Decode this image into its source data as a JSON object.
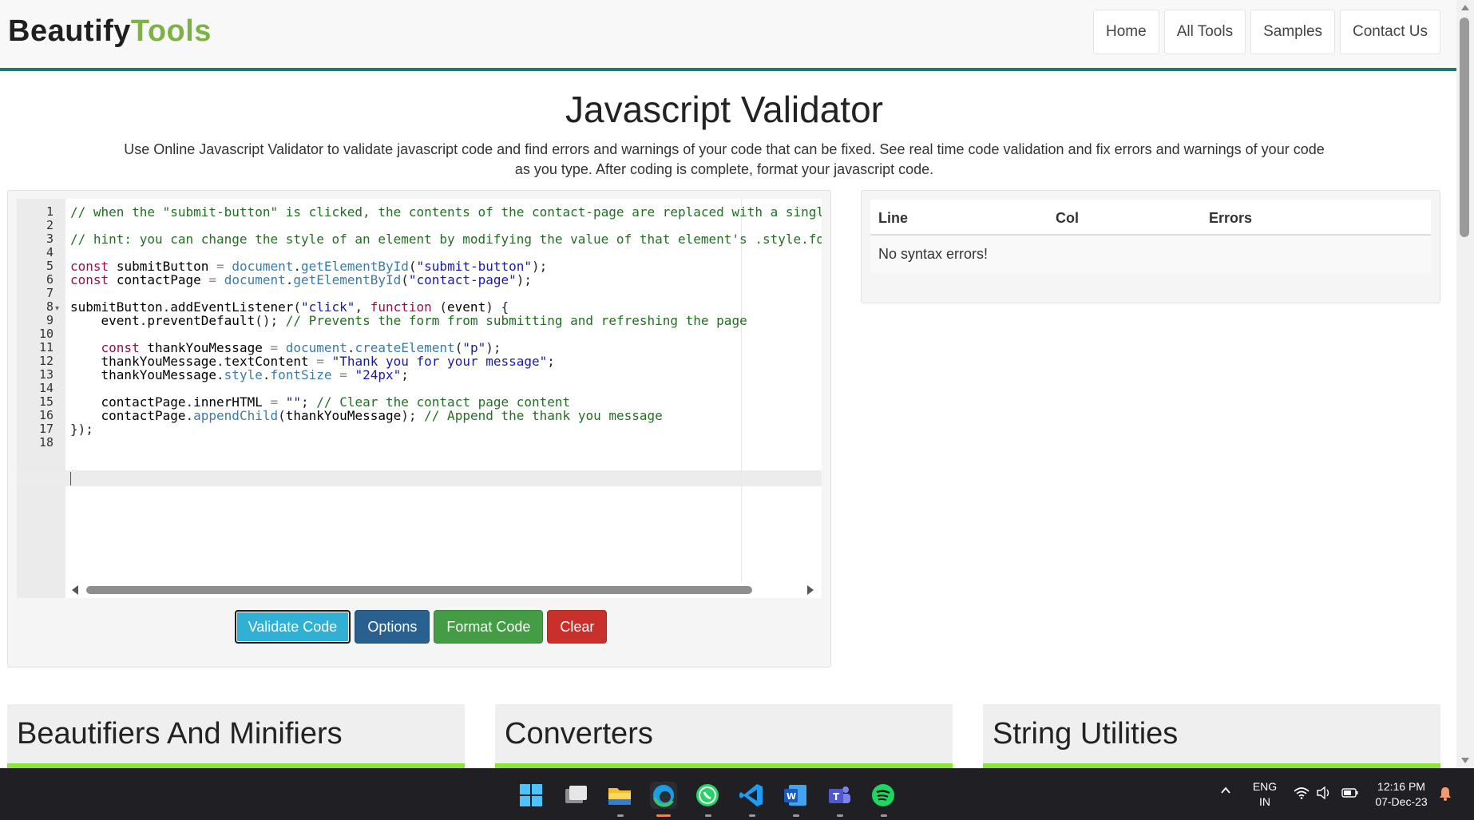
{
  "header": {
    "logo_part1": "Beautify",
    "logo_part2": "Tools",
    "nav": [
      "Home",
      "All Tools",
      "Samples",
      "Contact Us"
    ]
  },
  "page": {
    "title": "Javascript Validator",
    "description": "Use Online Javascript Validator to validate javascript code and find errors and warnings of your code that can be fixed. See real time code validation and fix errors and warnings of your code as you type. After coding is complete, format your javascript code."
  },
  "editor": {
    "line_numbers": [
      "1",
      "2",
      "3",
      "4",
      "5",
      "6",
      "7",
      "8",
      "9",
      "10",
      "11",
      "12",
      "13",
      "14",
      "15",
      "16",
      "17",
      "18"
    ],
    "lines": [
      "// when the \"submit-button\" is clicked, the contents of the contact-page are replaced with a singl",
      "",
      "// hint: you can change the style of an element by modifying the value of that element's .style.fo",
      "",
      "const submitButton = document.getElementById(\"submit-button\");",
      "const contactPage = document.getElementById(\"contact-page\");",
      "",
      "submitButton.addEventListener(\"click\", function (event) {",
      "    event.preventDefault(); // Prevents the form from submitting and refreshing the page",
      "",
      "    const thankYouMessage = document.createElement(\"p\");",
      "    thankYouMessage.textContent = \"Thank you for your message\";",
      "    thankYouMessage.style.fontSize = \"24px\";",
      "",
      "    contactPage.innerHTML = \"\"; // Clear the contact page content",
      "    contactPage.appendChild(thankYouMessage); // Append the thank you message",
      "});",
      ""
    ],
    "active_line": 18
  },
  "buttons": {
    "validate": "Validate Code",
    "options": "Options",
    "format": "Format Code",
    "clear": "Clear"
  },
  "results": {
    "columns": [
      "Line",
      "Col",
      "Errors"
    ],
    "message": "No syntax errors!"
  },
  "categories": [
    "Beautifiers And Minifiers",
    "Converters",
    "String Utilities"
  ],
  "taskbar": {
    "apps": [
      "windows-start-icon",
      "task-view-icon",
      "file-explorer-icon",
      "edge-icon",
      "whatsapp-icon",
      "vscode-icon",
      "word-icon",
      "teams-icon",
      "spotify-icon"
    ],
    "language_line1": "ENG",
    "language_line2": "IN",
    "time": "12:16 PM",
    "date": "07-Dec-23"
  },
  "colors": {
    "brand_dark": "#1f1f1f",
    "brand_green": "#7cb342",
    "header_border": "#1a7a74",
    "card_accent": "#8be33c",
    "validate_btn": "#31b0d5",
    "options_btn": "#286090",
    "format_btn": "#449d44",
    "clear_btn": "#c9302c"
  }
}
